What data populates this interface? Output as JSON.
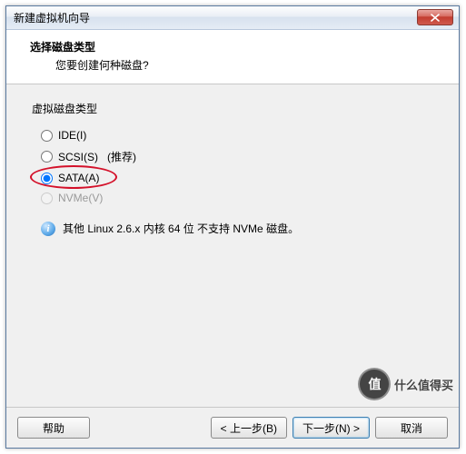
{
  "window": {
    "title": "新建虚拟机向导"
  },
  "header": {
    "title": "选择磁盘类型",
    "subtitle": "您要创建何种磁盘?"
  },
  "group": {
    "label": "虚拟磁盘类型",
    "options": {
      "ide": "IDE(I)",
      "scsi": "SCSI(S)",
      "recommend": "(推荐)",
      "sata": "SATA(A)",
      "nvme": "NVMe(V)"
    },
    "selected": "sata"
  },
  "info": {
    "icon": "i",
    "text": "其他 Linux 2.6.x 内核 64 位 不支持 NVMe 磁盘。"
  },
  "buttons": {
    "help": "帮助",
    "back": "< 上一步(B)",
    "next": "下一步(N) >",
    "cancel": "取消"
  },
  "watermark": {
    "badge": "值",
    "text": "什么值得买"
  }
}
